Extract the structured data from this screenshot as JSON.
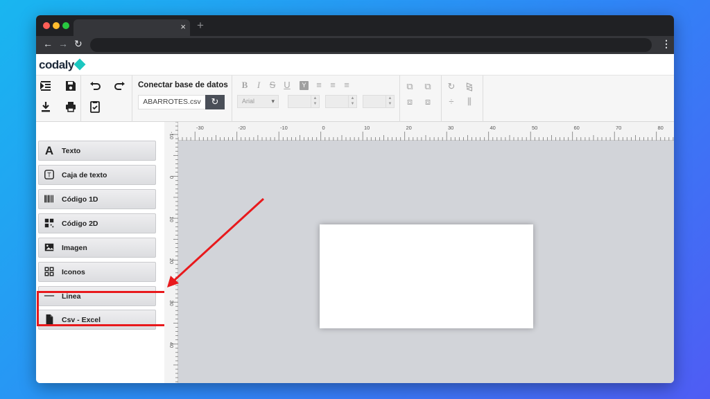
{
  "browser": {
    "close_glyph": "×",
    "new_tab_glyph": "+",
    "back_glyph": "←",
    "forward_glyph": "→",
    "reload_glyph": "↻",
    "menu_glyph": "⋮"
  },
  "app": {
    "logo_text": "codaly"
  },
  "toolbar": {
    "db_title": "Conectar base de datos",
    "db_file": "ABARROTES.csv",
    "font_value": "Arial",
    "text_style_icons": [
      "bold-icon",
      "italic-icon",
      "strikethrough-icon",
      "underline-icon",
      "text-color-icon",
      "align-left-icon",
      "align-center-icon",
      "align-right-icon"
    ],
    "arrange_icons": [
      "rotate-icon",
      "flip-horizontal-icon",
      "align-middle-icon",
      "distribute-icon"
    ]
  },
  "sidebar": {
    "items": [
      {
        "label": "Texto",
        "icon": "text-icon"
      },
      {
        "label": "Caja de texto",
        "icon": "textbox-icon"
      },
      {
        "label": "Código 1D",
        "icon": "barcode-icon"
      },
      {
        "label": "Código 2D",
        "icon": "qrcode-icon"
      },
      {
        "label": "Imagen",
        "icon": "image-icon"
      },
      {
        "label": "Iconos",
        "icon": "icons-grid-icon"
      },
      {
        "label": "Linea",
        "icon": "line-icon"
      },
      {
        "label": "Csv - Excel",
        "icon": "file-icon"
      }
    ]
  },
  "rulers": {
    "horizontal_labels": [
      "-30",
      "-20",
      "-10",
      "0",
      "10",
      "20",
      "30",
      "40",
      "50",
      "60",
      "70",
      "80"
    ],
    "vertical_labels": [
      "-10",
      "0",
      "10",
      "20",
      "30",
      "40"
    ]
  },
  "colors": {
    "highlight": "#e8191c",
    "accent": "#1cc7c0"
  }
}
